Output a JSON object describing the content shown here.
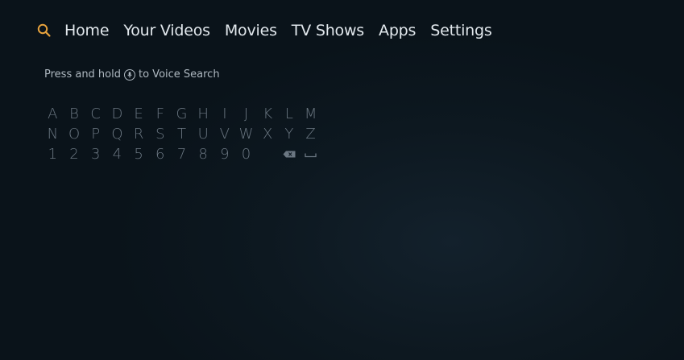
{
  "nav": {
    "items": [
      "Home",
      "Your Videos",
      "Movies",
      "TV Shows",
      "Apps",
      "Settings"
    ]
  },
  "colors": {
    "accent": "#e8a33d",
    "background": "#0d1820",
    "keys": "#6b7782"
  },
  "icons": {
    "search": "search-icon",
    "mic": "microphone-icon",
    "backspace": "backspace-icon",
    "space": "space-icon"
  },
  "hint": {
    "before": "Press and hold",
    "after": "to Voice Search"
  },
  "keyboard": {
    "row1": [
      "A",
      "B",
      "C",
      "D",
      "E",
      "F",
      "G",
      "H",
      "I",
      "J",
      "K",
      "L",
      "M"
    ],
    "row2": [
      "N",
      "O",
      "P",
      "Q",
      "R",
      "S",
      "T",
      "U",
      "V",
      "W",
      "X",
      "Y",
      "Z"
    ],
    "row3": [
      "1",
      "2",
      "3",
      "4",
      "5",
      "6",
      "7",
      "8",
      "9",
      "0"
    ]
  }
}
